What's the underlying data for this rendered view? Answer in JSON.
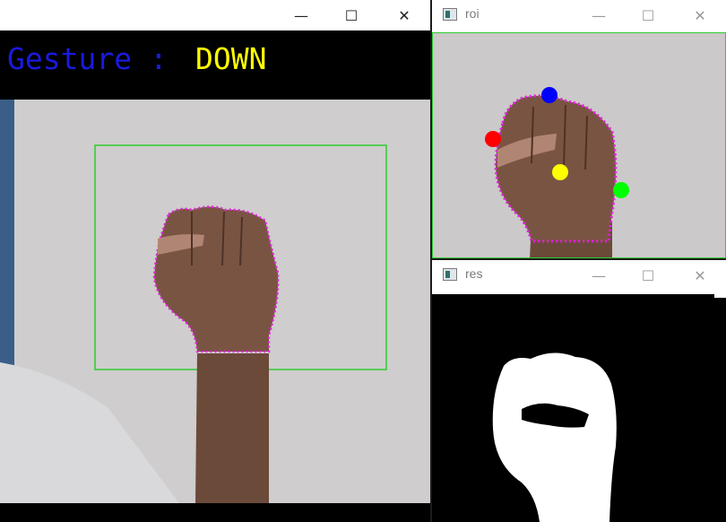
{
  "main_window": {
    "title": "",
    "overlay": {
      "label": "Gesture :",
      "value": "DOWN",
      "label_color": "#1a1ae0",
      "value_color": "#ffff00"
    }
  },
  "roi_window": {
    "title": "roi",
    "points": {
      "red": "#ff0000",
      "blue": "#0000ff",
      "yellow": "#ffff00",
      "green": "#00ff00"
    }
  },
  "res_window": {
    "title": "res"
  },
  "controls": {
    "minimize": "—",
    "maximize": "☐",
    "close": "✕"
  }
}
